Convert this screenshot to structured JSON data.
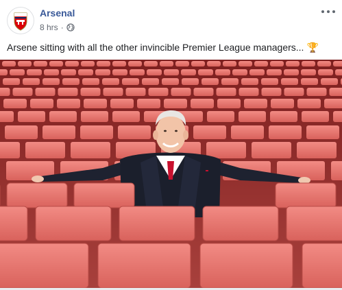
{
  "post": {
    "page_name": "Arsenal",
    "timestamp": "8 hrs",
    "separator": "·",
    "privacy_icon": "globe-icon",
    "more_icon": "more-options-icon",
    "caption": "Arsene sitting with all the other invincible Premier League managers...",
    "caption_emoji": "trophy-icon",
    "photo_subject": "man-in-stadium-seats"
  },
  "colors": {
    "page_name": "#385898",
    "meta_text": "#616770",
    "caption_text": "#1c1e21",
    "arsenal_red": "#db0007",
    "seat_red": "#e8706b"
  }
}
